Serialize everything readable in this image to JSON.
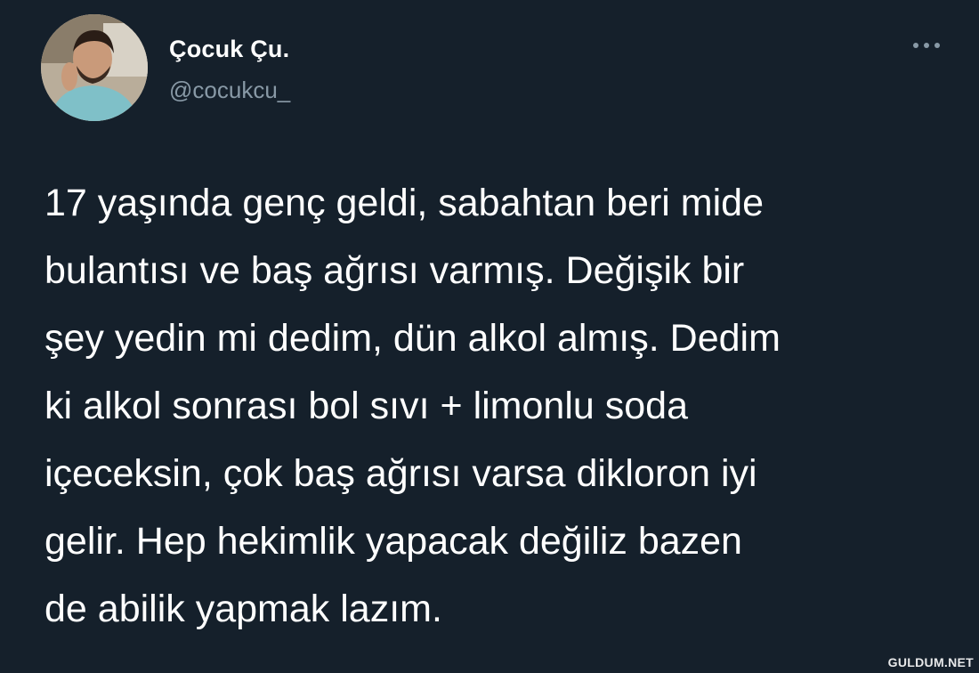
{
  "user": {
    "display_name": "Çocuk Çu.",
    "handle": "@cocukcu_"
  },
  "tweet": {
    "lines": [
      "17 yaşında genç geldi, sabahtan beri mide",
      "bulantısı ve baş ağrısı varmış. Değişik bir",
      "şey yedin mi dedim, dün alkol almış. Dedim",
      "ki alkol sonrası bol sıvı + limonlu soda",
      "içeceksin, çok baş ağrısı varsa dikloron iyi",
      "gelir. Hep hekimlik yapacak değiliz bazen",
      "de abilik yapmak lazım."
    ]
  },
  "icons": {
    "more": "more-horizontal-icon",
    "avatar": "profile-photo"
  },
  "watermark": "GULDUM.NET",
  "colors": {
    "background": "#15202b",
    "text_primary": "#ffffff",
    "text_secondary": "#8899a6"
  }
}
